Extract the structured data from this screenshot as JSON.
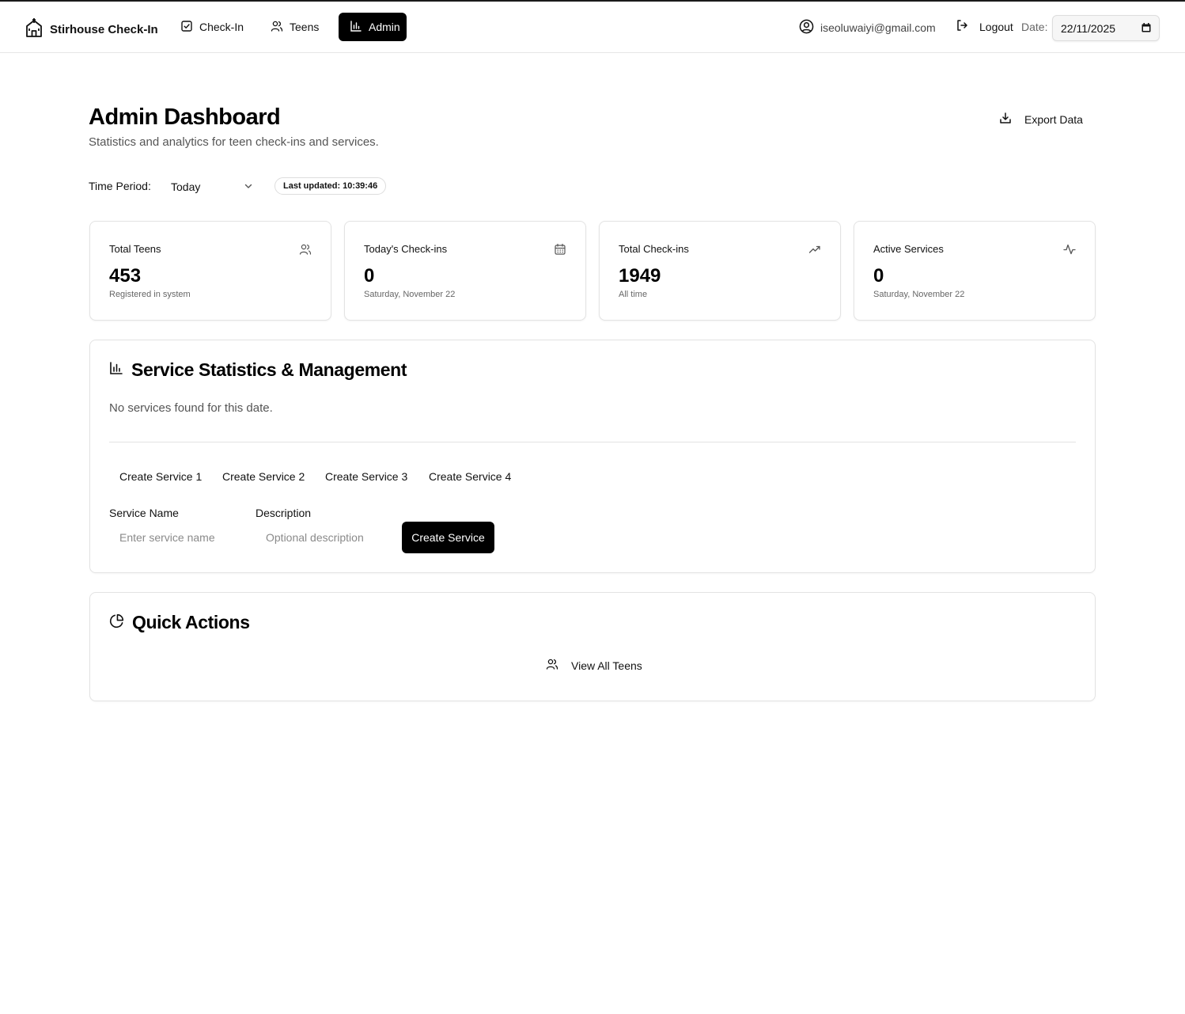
{
  "header": {
    "brand": "Stirhouse Check-In",
    "tabs": [
      {
        "label": "Check-In",
        "icon": "check-square-icon"
      },
      {
        "label": "Teens",
        "icon": "users-icon"
      },
      {
        "label": "Admin",
        "icon": "bar-chart-icon",
        "active": true
      }
    ],
    "user_email": "iseoluwaiyi@gmail.com",
    "logout_label": "Logout",
    "date_label": "Date:",
    "date_value": "22/11/2025"
  },
  "page": {
    "title": "Admin Dashboard",
    "subtitle": "Statistics and analytics for teen check-ins and services.",
    "export_label": "Export Data",
    "period_label": "Time Period:",
    "period_value": "Today",
    "last_updated": "Last updated: 10:39:46"
  },
  "stats": [
    {
      "title": "Total Teens",
      "value": "453",
      "sub": "Registered in system",
      "icon": "users-icon"
    },
    {
      "title": "Today's Check-ins",
      "value": "0",
      "sub": "Saturday, November 22",
      "icon": "calendar-icon"
    },
    {
      "title": "Total Check-ins",
      "value": "1949",
      "sub": "All time",
      "icon": "trending-up-icon"
    },
    {
      "title": "Active Services",
      "value": "0",
      "sub": "Saturday, November 22",
      "icon": "activity-icon"
    }
  ],
  "services": {
    "title": "Service Statistics & Management",
    "empty_message": "No services found for this date.",
    "tabs": [
      "Create Service 1",
      "Create Service 2",
      "Create Service 3",
      "Create Service 4"
    ],
    "name_label": "Service Name",
    "name_placeholder": "Enter service name",
    "desc_label": "Description",
    "desc_placeholder": "Optional description",
    "create_label": "Create Service"
  },
  "quick_actions": {
    "title": "Quick Actions",
    "view_teens_label": "View All Teens"
  },
  "colors": {
    "accent": "#000000",
    "border": "#e3e3e3",
    "muted_text": "#555555"
  }
}
